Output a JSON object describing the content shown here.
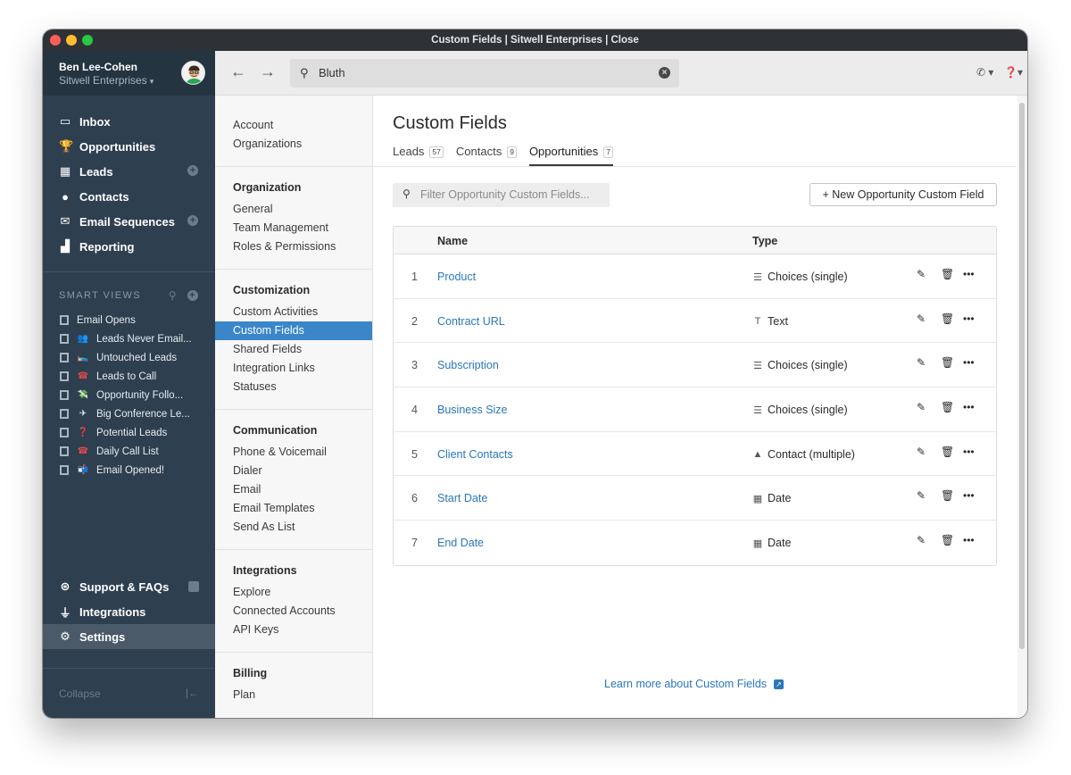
{
  "window": {
    "title": "Custom Fields | Sitwell Enterprises | Close"
  },
  "user": {
    "name": "Ben Lee-Cohen",
    "org": "Sitwell Enterprises"
  },
  "nav": {
    "items": [
      {
        "label": "Inbox",
        "icon": "inbox-icon"
      },
      {
        "label": "Opportunities",
        "icon": "trophy-icon"
      },
      {
        "label": "Leads",
        "icon": "building-icon",
        "has_add": true
      },
      {
        "label": "Contacts",
        "icon": "person-icon"
      },
      {
        "label": "Email Sequences",
        "icon": "envelope-icon",
        "has_add": true
      },
      {
        "label": "Reporting",
        "icon": "chart-icon"
      }
    ],
    "bottom": [
      {
        "label": "Support & FAQs",
        "icon": "lifebuoy-icon"
      },
      {
        "label": "Integrations",
        "icon": "plug-icon"
      },
      {
        "label": "Settings",
        "icon": "gear-icon"
      }
    ],
    "collapse_label": "Collapse"
  },
  "smart_views": {
    "heading": "SMART VIEWS",
    "items": [
      {
        "label": "Email Opens",
        "emoji": ""
      },
      {
        "label": "Leads Never Email...",
        "emoji": "👥"
      },
      {
        "label": "Untouched Leads",
        "emoji": "🛌"
      },
      {
        "label": "Leads to Call",
        "emoji": "☎"
      },
      {
        "label": "Opportunity Follo...",
        "emoji": "💸"
      },
      {
        "label": "Big Conference Le...",
        "emoji": "✈"
      },
      {
        "label": "Potential Leads",
        "emoji": "❓"
      },
      {
        "label": "Daily Call List",
        "emoji": "☎"
      },
      {
        "label": "Email Opened!",
        "emoji": "📬"
      }
    ]
  },
  "search": {
    "value": "Bluth"
  },
  "settings_nav": {
    "top_items": [
      "Account",
      "Organizations"
    ],
    "groups": [
      {
        "heading": "Organization",
        "items": [
          "General",
          "Team Management",
          "Roles & Permissions"
        ]
      },
      {
        "heading": "Customization",
        "items": [
          "Custom Activities",
          "Custom Fields",
          "Shared Fields",
          "Integration Links",
          "Statuses"
        ]
      },
      {
        "heading": "Communication",
        "items": [
          "Phone & Voicemail",
          "Dialer",
          "Email",
          "Email Templates",
          "Send As List"
        ]
      },
      {
        "heading": "Integrations",
        "items": [
          "Explore",
          "Connected Accounts",
          "API Keys"
        ]
      },
      {
        "heading": "Billing",
        "items": [
          "Plan"
        ]
      }
    ],
    "active": "Custom Fields"
  },
  "page": {
    "title": "Custom Fields",
    "tabs": [
      {
        "label": "Leads",
        "count": "57"
      },
      {
        "label": "Contacts",
        "count": "9"
      },
      {
        "label": "Opportunities",
        "count": "7"
      }
    ],
    "active_tab": "Opportunities",
    "filter_placeholder": "Filter Opportunity Custom Fields...",
    "new_button": "New Opportunity Custom Field",
    "columns": {
      "name": "Name",
      "type": "Type"
    },
    "rows": [
      {
        "num": "1",
        "name": "Product",
        "type": "Choices (single)",
        "type_icon": "list-icon"
      },
      {
        "num": "2",
        "name": "Contract URL",
        "type": "Text",
        "type_icon": "text-icon"
      },
      {
        "num": "3",
        "name": "Subscription",
        "type": "Choices (single)",
        "type_icon": "list-icon"
      },
      {
        "num": "4",
        "name": "Business Size",
        "type": "Choices (single)",
        "type_icon": "list-icon"
      },
      {
        "num": "5",
        "name": "Client Contacts",
        "type": "Contact (multiple)",
        "type_icon": "person-icon"
      },
      {
        "num": "6",
        "name": "Start Date",
        "type": "Date",
        "type_icon": "calendar-icon"
      },
      {
        "num": "7",
        "name": "End Date",
        "type": "Date",
        "type_icon": "calendar-icon"
      }
    ],
    "learn_more": "Learn more about Custom Fields"
  },
  "colors": {
    "sidebar": "#2e3f50",
    "link": "#2a77bb",
    "active_nav": "#3a86c8"
  }
}
